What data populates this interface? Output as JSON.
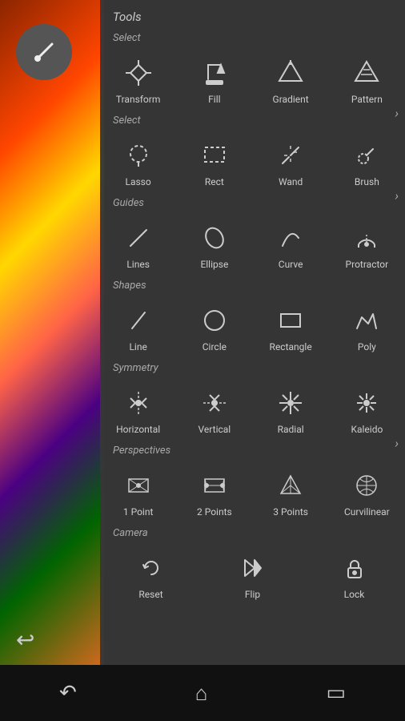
{
  "panel": {
    "header": "Tools",
    "sections": [
      {
        "label": "Select",
        "tools": [
          {
            "name": "Transform",
            "icon": "transform"
          },
          {
            "name": "Fill",
            "icon": "fill"
          },
          {
            "name": "Gradient",
            "icon": "gradient"
          },
          {
            "name": "Pattern",
            "icon": "pattern"
          }
        ]
      },
      {
        "label": "Select",
        "tools": [
          {
            "name": "Lasso",
            "icon": "lasso"
          },
          {
            "name": "Rect",
            "icon": "rect"
          },
          {
            "name": "Wand",
            "icon": "wand"
          },
          {
            "name": "Brush",
            "icon": "brush"
          }
        ]
      },
      {
        "label": "Guides",
        "tools": [
          {
            "name": "Lines",
            "icon": "lines"
          },
          {
            "name": "Ellipse",
            "icon": "ellipse"
          },
          {
            "name": "Curve",
            "icon": "curve"
          },
          {
            "name": "Protractor",
            "icon": "protractor"
          }
        ]
      },
      {
        "label": "Shapes",
        "tools": [
          {
            "name": "Line",
            "icon": "line"
          },
          {
            "name": "Circle",
            "icon": "circle"
          },
          {
            "name": "Rectangle",
            "icon": "rectangle"
          },
          {
            "name": "Poly",
            "icon": "poly"
          }
        ]
      },
      {
        "label": "Symmetry",
        "tools": [
          {
            "name": "Horizontal",
            "icon": "horizontal"
          },
          {
            "name": "Vertical",
            "icon": "vertical"
          },
          {
            "name": "Radial",
            "icon": "radial"
          },
          {
            "name": "Kaleido",
            "icon": "kaleido"
          }
        ]
      },
      {
        "label": "Perspectives",
        "tools": [
          {
            "name": "1 Point",
            "icon": "1point"
          },
          {
            "name": "2 Points",
            "icon": "2points"
          },
          {
            "name": "3 Points",
            "icon": "3points"
          },
          {
            "name": "Curvilinear",
            "icon": "curvilinear"
          }
        ]
      },
      {
        "label": "Camera",
        "tools": [
          {
            "name": "Reset",
            "icon": "reset"
          },
          {
            "name": "Flip",
            "icon": "flip"
          },
          {
            "name": "Lock",
            "icon": "lock"
          }
        ]
      }
    ]
  },
  "nav": {
    "back": "←",
    "home": "⌂",
    "recent": "▣"
  }
}
